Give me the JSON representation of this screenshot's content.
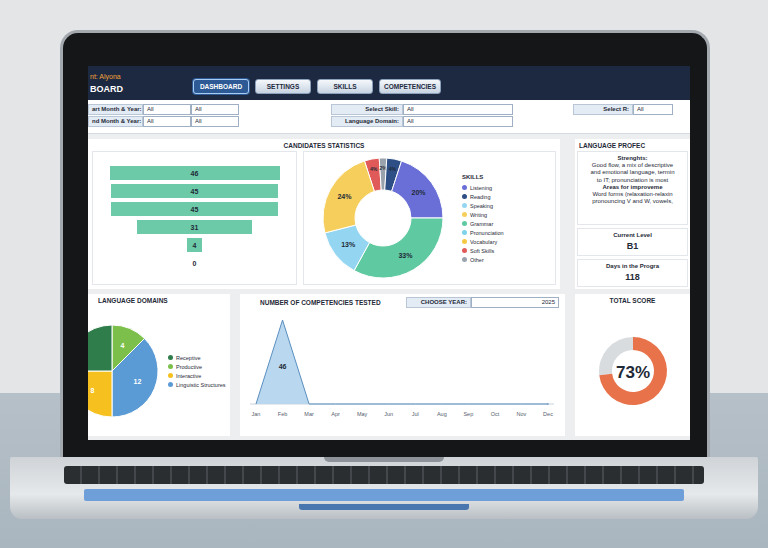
{
  "header": {
    "user": "nt: Alyona",
    "title": "BOARD"
  },
  "tabs": [
    {
      "label": "DASHBOARD",
      "selected": true
    },
    {
      "label": "SETTINGS",
      "selected": false
    },
    {
      "label": "SKILLS",
      "selected": false
    },
    {
      "label": "COMPETENCIES",
      "selected": false
    }
  ],
  "filters": {
    "date_rows": [
      {
        "label": "art Month & Year:",
        "values": [
          "All",
          "All"
        ]
      },
      {
        "label": "nd Month & Year:",
        "values": [
          "All",
          "All"
        ]
      }
    ],
    "select_rows": [
      {
        "label": "Select Skill:",
        "value": "All"
      },
      {
        "label": "Language Domain:",
        "value": "All"
      }
    ],
    "rater": {
      "label": "Select R:",
      "value": "All"
    }
  },
  "candidates": {
    "title": "CANDIDATES STATISTICS",
    "funnel": {
      "values": [
        46,
        45,
        45,
        31,
        4,
        0
      ],
      "labels": [
        "46",
        "45",
        "45",
        "31",
        "4",
        "0"
      ]
    },
    "skills_donut": {
      "segments": [
        {
          "value": 4,
          "label": "4%",
          "color": "#e05a5a"
        },
        {
          "value": 2,
          "label": "2%",
          "color": "#9aa3ad"
        },
        {
          "value": 4,
          "label": "4%",
          "color": "#2e4f86"
        },
        {
          "value": 20,
          "label": "20%",
          "color": "#6a6fd8"
        },
        {
          "value": 33,
          "label": "33%",
          "color": "#5fc9a2"
        },
        {
          "value": 13,
          "label": "13%",
          "color": "#94d6f2"
        },
        {
          "value": 24,
          "label": "24%",
          "color": "#f6ce5c"
        }
      ]
    },
    "legend": {
      "title": "SKILLS",
      "items": [
        {
          "name": "Listening",
          "color": "#6a6fd8"
        },
        {
          "name": "Reading",
          "color": "#2e4f86"
        },
        {
          "name": "Speaking",
          "color": "#94d6f2"
        },
        {
          "name": "Writing",
          "color": "#f6ce5c"
        },
        {
          "name": "Grammar",
          "color": "#5fc9a2"
        },
        {
          "name": "Pronunciation",
          "color": "#7fd3e8"
        },
        {
          "name": "Vocabulary",
          "color": "#f6c945"
        },
        {
          "name": "Soft Skills",
          "color": "#e05a5a"
        },
        {
          "name": "Other",
          "color": "#9aa3ad"
        }
      ]
    }
  },
  "profile": {
    "title": "LANGUAGE PROFEC",
    "strengths_label": "Strenghts:",
    "strengths": [
      "Good flow, a mix of descriptive",
      "and emotional language, termin",
      "to IT; pronunciation is most"
    ],
    "improve_label": "Areas for improveme",
    "improve": [
      "Word forms (relaxation-relaxin",
      "pronouncing V and W, vowels,"
    ],
    "level_label": "Current Level",
    "level": "B1",
    "days_label": "Days in the Progra",
    "days": "118"
  },
  "domains": {
    "title": "LANGUAGE DOMAINS",
    "slices": [
      {
        "value": 4,
        "label": "4",
        "color": "#7cc04b"
      },
      {
        "value": 12,
        "label": "12",
        "color": "#5b9bd5"
      },
      {
        "value": 8,
        "label": "8",
        "color": "#f6c01e"
      },
      {
        "value": 8,
        "color": "#2e7d4a"
      }
    ],
    "legend": [
      {
        "name": "Receptive",
        "color": "#2e7d4a"
      },
      {
        "name": "Productive",
        "color": "#7cc04b"
      },
      {
        "name": "Interactive",
        "color": "#f6c01e"
      },
      {
        "name": "Linguistic Structures",
        "color": "#5b9bd5"
      }
    ]
  },
  "competencies": {
    "title": "NUMBER OF COMPETENCIES TESTED",
    "year_label": "CHOOSE YEAR:",
    "year": "2025",
    "months": [
      "Jan",
      "Feb",
      "Mar",
      "Apr",
      "May",
      "Jun",
      "Jul",
      "Aug",
      "Sep",
      "Oct",
      "Nov",
      "Dec"
    ],
    "values": [
      0,
      46,
      0,
      0,
      0,
      0,
      0,
      0,
      0,
      0,
      0,
      0
    ],
    "value_labels": [
      {
        "index": 1,
        "text": "46"
      }
    ]
  },
  "total": {
    "title": "TOTAL SCORE",
    "level": 0.73,
    "text": "73%"
  }
}
